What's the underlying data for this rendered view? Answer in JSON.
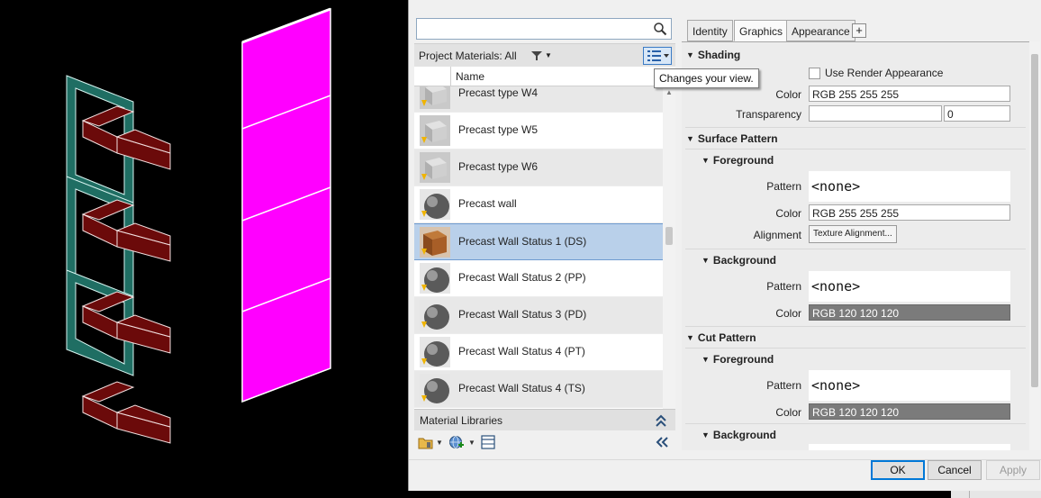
{
  "browser": {
    "search": {
      "placeholder": "",
      "value": ""
    },
    "project_label": "Project Materials: All",
    "column_name": "Name",
    "materials": [
      {
        "name": "Precast type W4",
        "thumb": "concrete-block",
        "selected": false
      },
      {
        "name": "Precast type W5",
        "thumb": "concrete-block",
        "selected": false
      },
      {
        "name": "Precast type W6",
        "thumb": "concrete-block",
        "selected": false
      },
      {
        "name": "Precast wall",
        "thumb": "gray-sphere",
        "selected": false
      },
      {
        "name": "Precast Wall Status 1 (DS)",
        "thumb": "brown-block",
        "selected": true
      },
      {
        "name": "Precast Wall Status 2 (PP)",
        "thumb": "gray-sphere",
        "selected": false
      },
      {
        "name": "Precast Wall Status 3 (PD)",
        "thumb": "gray-sphere",
        "selected": false
      },
      {
        "name": "Precast Wall Status 4 (PT)",
        "thumb": "gray-sphere",
        "selected": false
      },
      {
        "name": "Precast Wall Status 4 (TS)",
        "thumb": "gray-sphere",
        "selected": false
      }
    ],
    "library_label": "Material Libraries"
  },
  "tooltip": "Changes your view.",
  "editor": {
    "tabs": [
      {
        "label": "Identity",
        "active": false
      },
      {
        "label": "Graphics",
        "active": true
      },
      {
        "label": "Appearance",
        "active": false
      }
    ],
    "tab_add": "+",
    "shading": {
      "title": "Shading",
      "use_render_label": "Use Render Appearance",
      "color_label": "Color",
      "color_value": "RGB 255 255 255",
      "transparency_label": "Transparency",
      "transparency_value": "0"
    },
    "surface_pattern": {
      "title": "Surface Pattern",
      "foreground": {
        "title": "Foreground",
        "pattern_label": "Pattern",
        "pattern_value": "<none>",
        "color_label": "Color",
        "color_value": "RGB 255 255 255",
        "alignment_label": "Alignment",
        "alignment_button": "Texture Alignment..."
      },
      "background": {
        "title": "Background",
        "pattern_label": "Pattern",
        "pattern_value": "<none>",
        "color_label": "Color",
        "color_value": "RGB 120 120 120"
      }
    },
    "cut_pattern": {
      "title": "Cut Pattern",
      "foreground": {
        "title": "Foreground",
        "pattern_label": "Pattern",
        "pattern_value": "<none>",
        "color_label": "Color",
        "color_value": "RGB 120 120 120"
      },
      "background": {
        "title": "Background"
      }
    }
  },
  "buttons": {
    "ok": "OK",
    "cancel": "Cancel",
    "apply": "Apply"
  },
  "colors": {
    "magenta_panel": "#ff00ff",
    "frame_teal": "#1f6e63",
    "bracket_red": "#6b0a0a",
    "selection": "#b9d0ea",
    "dark_swatch": "#7b7b7b"
  }
}
